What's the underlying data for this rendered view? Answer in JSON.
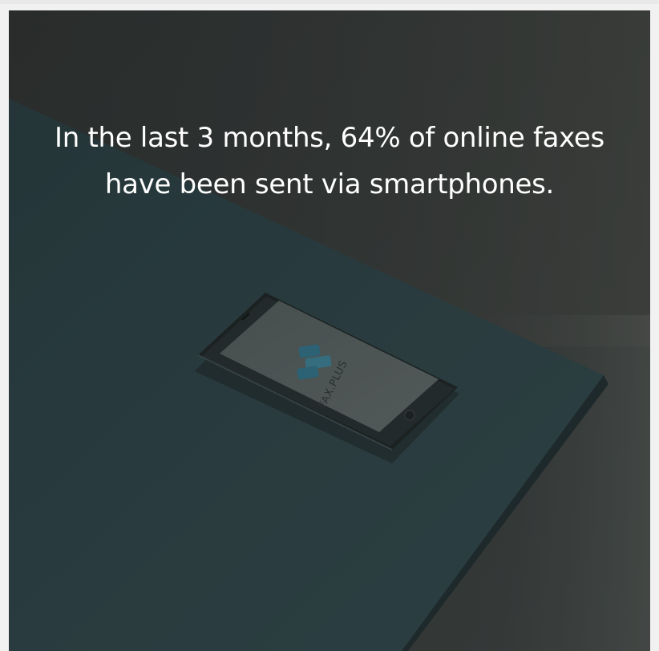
{
  "headline": {
    "line1": "In the last 3 months, 64% of online faxes",
    "line2": "have been sent via smartphones."
  },
  "phone_screen": {
    "logo_text": "FAX.PLUS"
  },
  "colors": {
    "overlay": "#2a3232",
    "text": "#ffffff",
    "logo_accent": "#2f6f85"
  }
}
